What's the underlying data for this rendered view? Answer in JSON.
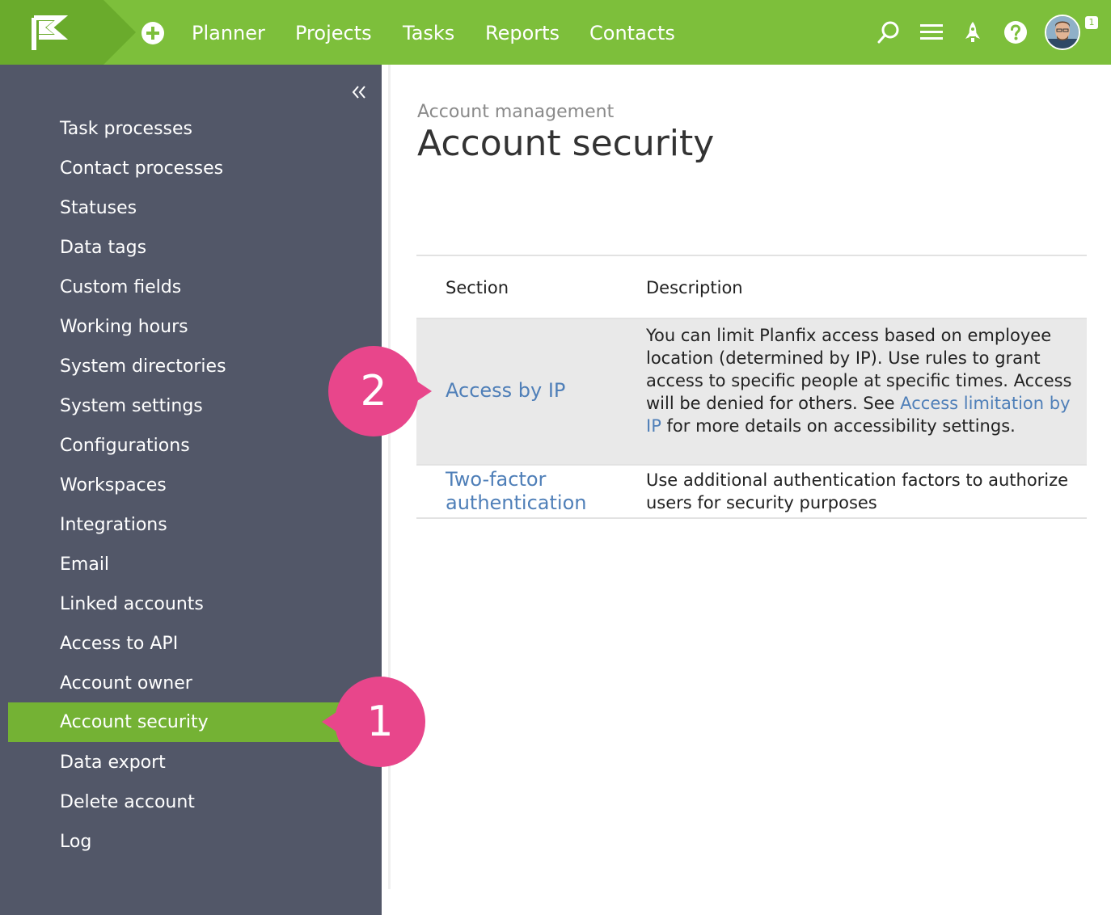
{
  "colors": {
    "topbar": "#7dbf3b",
    "sidebar": "#525768",
    "sidebar_active": "#74b234",
    "link": "#4f7fb8",
    "marker": "#e8468b"
  },
  "topbar": {
    "nav": {
      "planner": "Planner",
      "projects": "Projects",
      "tasks": "Tasks",
      "reports": "Reports",
      "contacts": "Contacts"
    },
    "icons": [
      "flag-logo-icon",
      "plus-circle-icon",
      "search-icon",
      "menu-icon",
      "rocket-icon",
      "help-icon",
      "avatar"
    ],
    "notification_count": "1"
  },
  "sidebar": {
    "active_item": "Account security",
    "items": [
      "Task processes",
      "Contact processes",
      "Statuses",
      "Data tags",
      "Custom fields",
      "Working hours",
      "System directories",
      "System settings",
      "Configurations",
      "Workspaces",
      "Integrations",
      "Email",
      "Linked accounts",
      "Access to API",
      "Account owner",
      "Account security",
      "Data export",
      "Delete account",
      "Log"
    ]
  },
  "main": {
    "breadcrumb": "Account management",
    "title": "Account security",
    "table": {
      "headers": {
        "section": "Section",
        "description": "Description"
      },
      "rows": [
        {
          "section": "Access by IP",
          "desc_part1": "You can limit Planfix access based on employee location (determined by IP). Use rules to grant access to specific people at specific times. Access will be denied for others. See ",
          "desc_link": "Access limitation by IP",
          "desc_part2": " for more details on accessibility settings."
        },
        {
          "section": "Two-factor authentication",
          "description": "Use additional authentication factors to authorize users for security purposes"
        }
      ]
    }
  },
  "markers": {
    "step1": "1",
    "step2": "2"
  }
}
